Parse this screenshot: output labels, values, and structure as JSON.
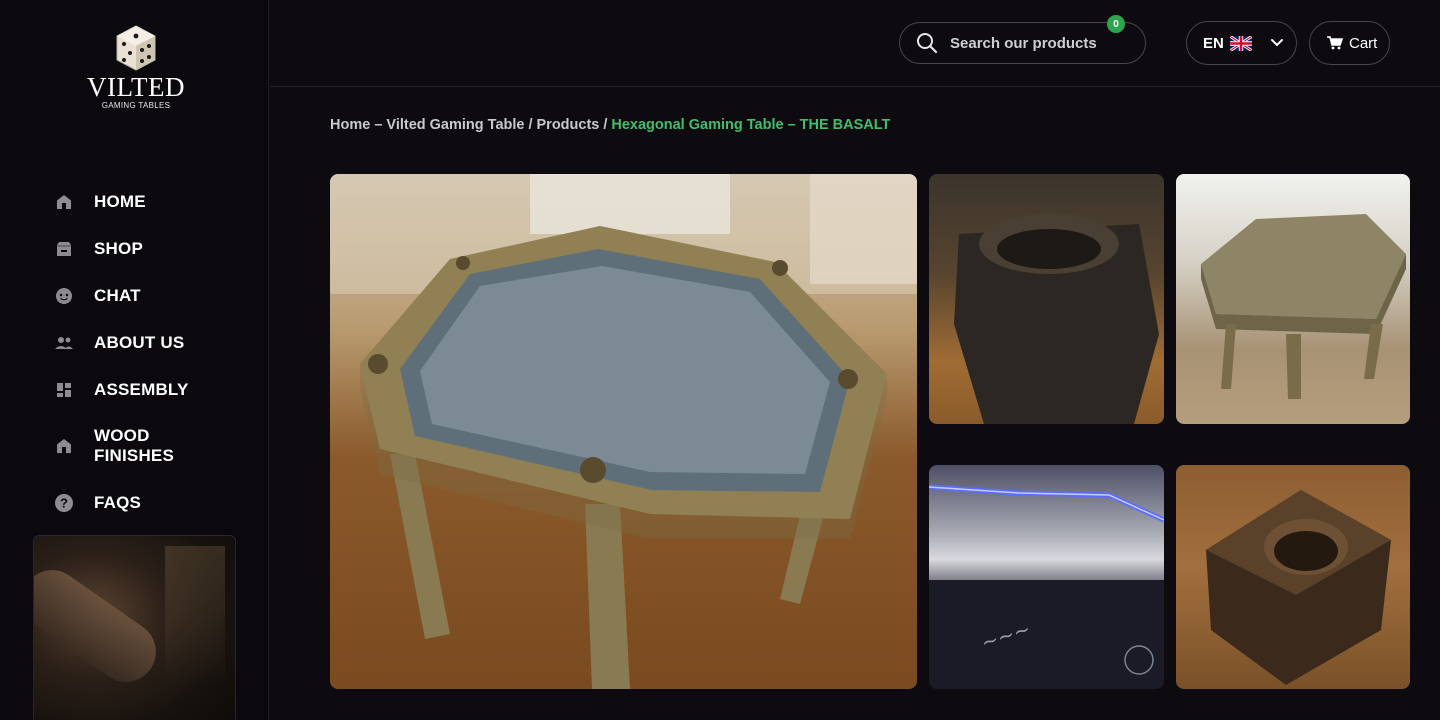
{
  "brand": {
    "name": "VILTED",
    "tagline": "GAMING TABLES"
  },
  "nav": [
    {
      "label": "HOME",
      "icon": "home-icon"
    },
    {
      "label": "SHOP",
      "icon": "shop-icon"
    },
    {
      "label": "CHAT",
      "icon": "chat-icon"
    },
    {
      "label": "ABOUT US",
      "icon": "people-icon"
    },
    {
      "label": "ASSEMBLY",
      "icon": "dashboard-icon"
    },
    {
      "label": "WOOD FINISHES",
      "icon": "home-icon"
    },
    {
      "label": "FAQS",
      "icon": "help-icon"
    }
  ],
  "header": {
    "search_placeholder": "Search our products",
    "language": "EN",
    "language_flag": "uk-flag-icon",
    "cart_label": "Cart",
    "cart_count": "0"
  },
  "breadcrumb": {
    "home": "Home – Vilted Gaming Table",
    "sep1": "/",
    "products": "Products",
    "sep2": "/",
    "current": "Hexagonal Gaming Table – THE BASALT"
  },
  "colors": {
    "accent": "#3fbf6b",
    "badge": "#2da44e",
    "background": "#0d0b10"
  }
}
